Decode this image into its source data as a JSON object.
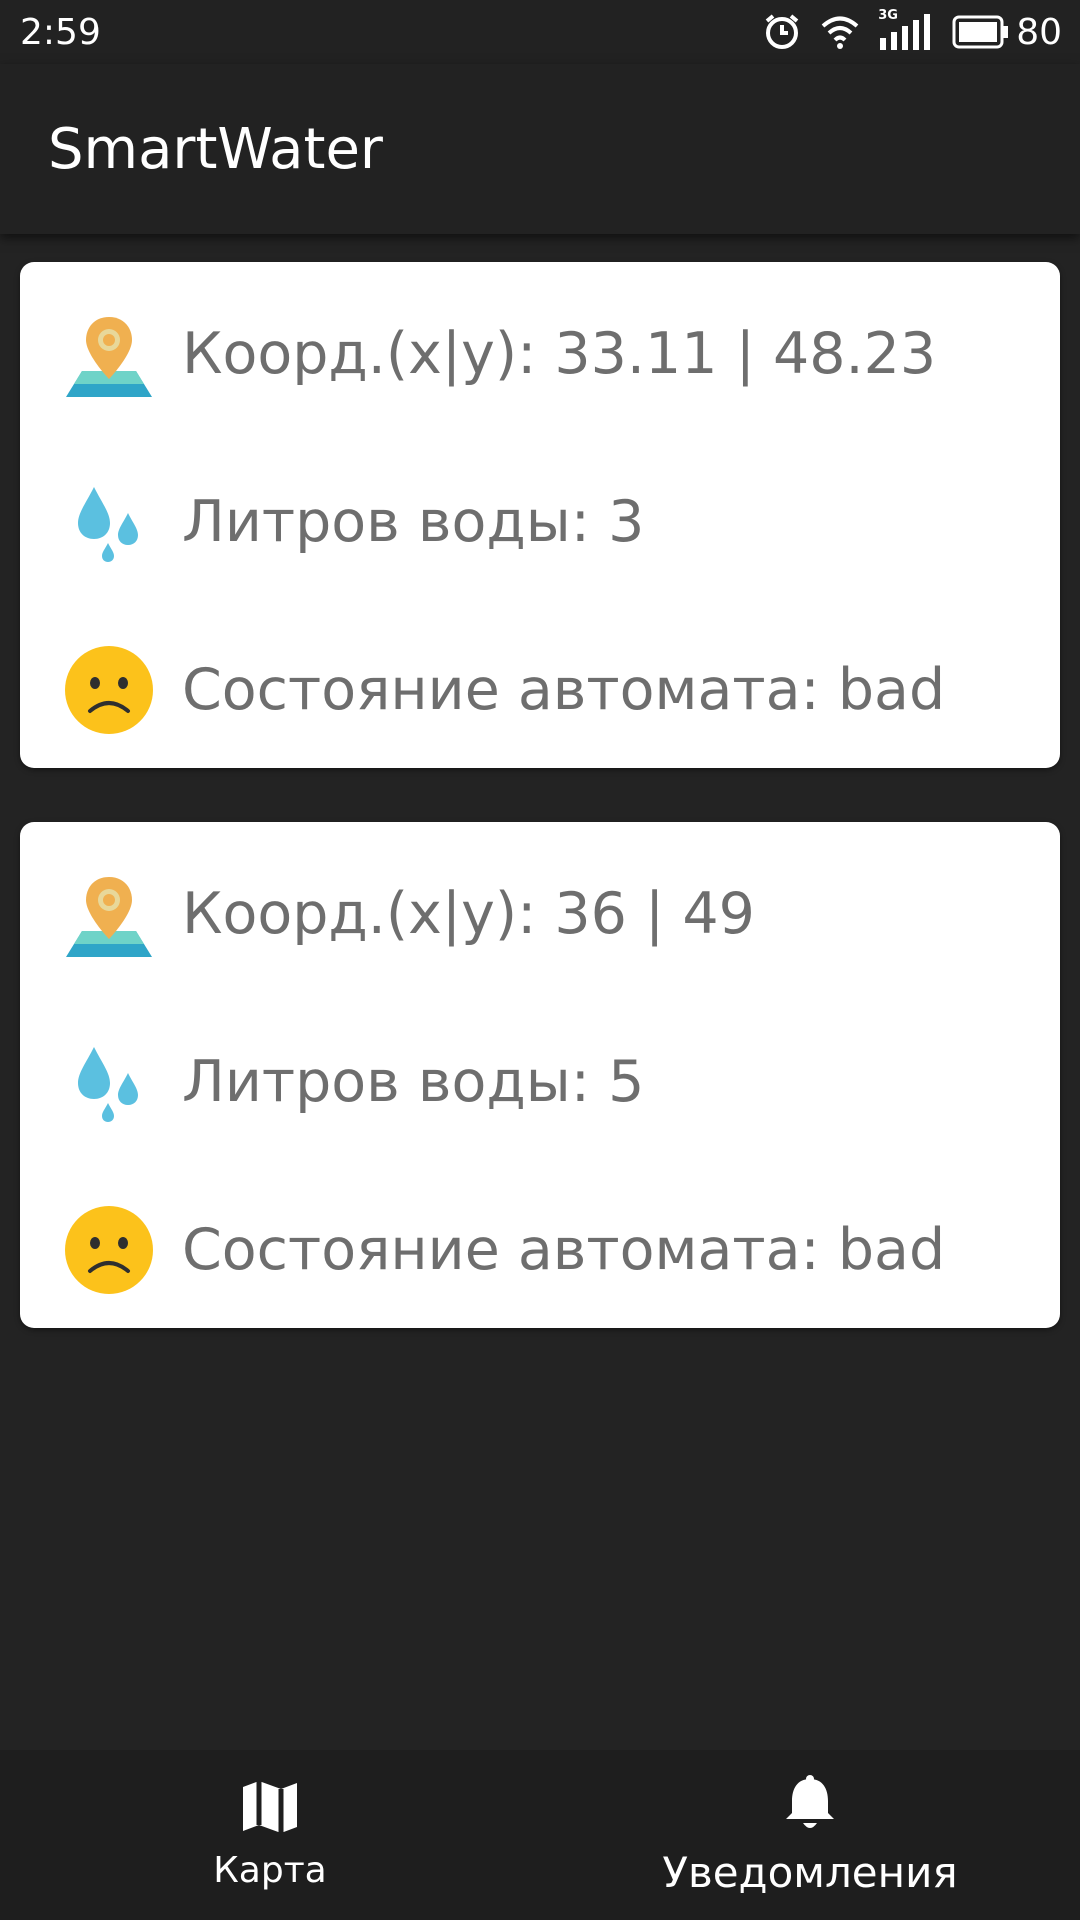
{
  "status_bar": {
    "time": "2:59",
    "network_label": "3G",
    "battery_level": "80",
    "icons": [
      "alarm-icon",
      "wifi-icon",
      "cell-signal-icon",
      "battery-icon"
    ]
  },
  "app_bar": {
    "title": "SmartWater"
  },
  "cards": [
    {
      "coords": "Коорд.(x|y): 33.11 | 48.23",
      "water": "Литров воды: 3",
      "state": "Состояние автомата: bad"
    },
    {
      "coords": "Коорд.(x|y): 36 | 49",
      "water": "Литров воды: 5",
      "state": "Состояние автомата: bad"
    }
  ],
  "bottom_nav": {
    "items": [
      {
        "label": "Карта",
        "icon": "map-icon"
      },
      {
        "label": "Уведомления",
        "icon": "bell-icon",
        "active": true
      }
    ]
  },
  "colors": {
    "background": "#232323",
    "card": "#ffffff",
    "text_secondary": "#6e6e6e",
    "emoji_yellow": "#fcc21b",
    "pin_orange": "#f0b050",
    "water_blue": "#5bc0e0"
  }
}
